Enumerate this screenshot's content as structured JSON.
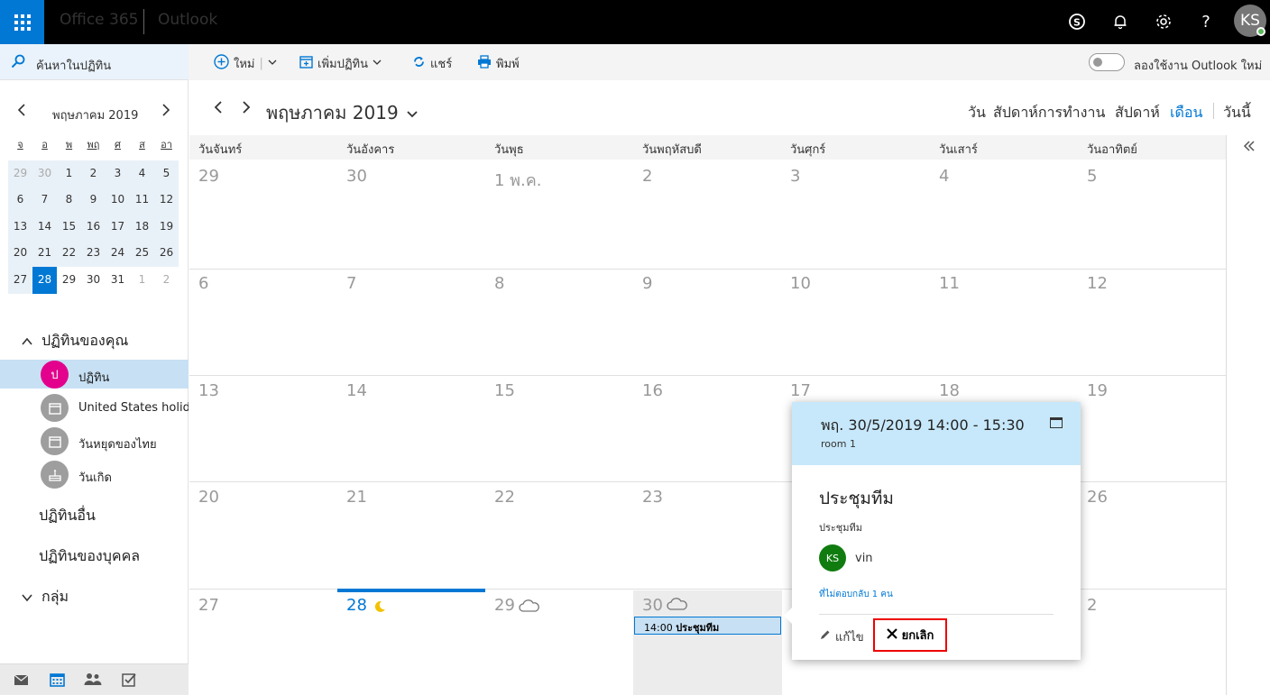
{
  "topbar": {
    "brand": "Office 365",
    "app": "Outlook",
    "icons": [
      "waffle-icon",
      "skype-icon",
      "bell-icon",
      "gear-icon",
      "help-icon"
    ],
    "help_glyph": "?",
    "avatar_initials": "KS"
  },
  "search": {
    "label": "ค้นหาในปฏิทิน"
  },
  "toolbar": {
    "new_label": "ใหม่",
    "add_calendar_label": "เพิ่มปฏิทิน",
    "share_label": "แชร์",
    "print_label": "พิมพ์",
    "try_new_label": "ลองใช้งาน Outlook ใหม่",
    "try_new_on": false
  },
  "mini_calendar": {
    "title": "พฤษภาคม 2019",
    "weekdays": [
      "จ",
      "อ",
      "พ",
      "พฤ",
      "ศ",
      "ส",
      "อา"
    ],
    "weeks": [
      [
        "29",
        "30",
        "1",
        "2",
        "3",
        "4",
        "5"
      ],
      [
        "6",
        "7",
        "8",
        "9",
        "10",
        "11",
        "12"
      ],
      [
        "13",
        "14",
        "15",
        "16",
        "17",
        "18",
        "19"
      ],
      [
        "20",
        "21",
        "22",
        "23",
        "24",
        "25",
        "26"
      ],
      [
        "27",
        "28",
        "29",
        "30",
        "31",
        "1",
        "2"
      ]
    ],
    "today": "28"
  },
  "calendars": {
    "your_calendars_label": "ปฏิทินของคุณ",
    "items": [
      {
        "label": "ปฏิทิน",
        "initial": "ป",
        "color": "#e3008c"
      },
      {
        "label": "United States holidays",
        "color": "#9e9e9e"
      },
      {
        "label": "วันหยุดของไทย",
        "color": "#9e9e9e"
      },
      {
        "label": "วันเกิด",
        "color": "#9e9e9e"
      }
    ],
    "other_label": "ปฏิทินอื่น",
    "people_label": "ปฏิทินของบุคคล",
    "groups_label": "กลุ่ม"
  },
  "main": {
    "title": "พฤษภาคม 2019",
    "views": {
      "day": "วัน",
      "work_week": "สัปดาห์การทำงาน",
      "week": "สัปดาห์",
      "month": "เดือน",
      "today": "วันนี้"
    },
    "active_view": "month",
    "day_names": [
      "วันจันทร์",
      "วันอังคาร",
      "วันพุธ",
      "วันพฤหัสบดี",
      "วันศุกร์",
      "วันเสาร์",
      "วันอาทิตย์"
    ],
    "weeks": [
      [
        "29",
        "30",
        "1 พ.ค.",
        "2",
        "3",
        "4",
        "5"
      ],
      [
        "6",
        "7",
        "8",
        "9",
        "10",
        "11",
        "12"
      ],
      [
        "13",
        "14",
        "15",
        "16",
        "17",
        "18",
        "19"
      ],
      [
        "20",
        "21",
        "22",
        "23",
        "",
        "",
        "26"
      ],
      [
        "27",
        "28",
        "29",
        "30",
        "",
        "",
        "2"
      ]
    ],
    "today_date": "28"
  },
  "event_chip": {
    "time": "14:00",
    "title": "ประชุมทีม"
  },
  "popup": {
    "when": "พฤ. 30/5/2019 14:00 - 15:30",
    "room": "room 1",
    "title": "ประชุมทีม",
    "description": "ประชุมทีม",
    "attendee_initials": "KS",
    "attendee_name": "vin",
    "no_response": "ที่ไม่ตอบกลับ 1 คน",
    "edit_label": "แก้ไข",
    "cancel_label": "ยกเลิก"
  }
}
